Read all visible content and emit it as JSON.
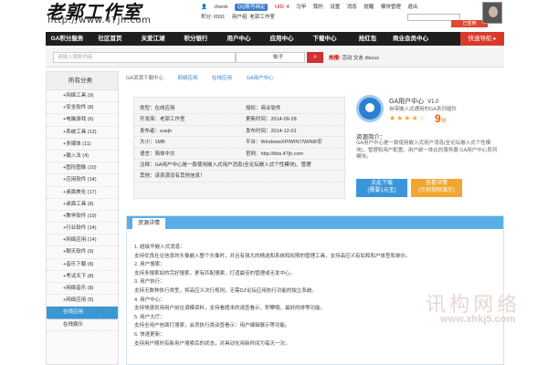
{
  "site": {
    "logo": "老郭工作室",
    "url": "http://www.47jh.com"
  },
  "userbar": {
    "user": "chenb",
    "qq": "QQ账号绑定",
    "uid": "UID: 4",
    "nav1": [
      "马甲",
      "我的",
      "设置",
      "消息",
      "提醒",
      "模块管理",
      "退出"
    ],
    "points": "积分: 6591",
    "group": "用户组: 老郭工作室",
    "search_placeholder": "",
    "go": "已签到"
  },
  "nav": [
    "GA积分服务",
    "社区首页",
    "关爱江湖",
    "积分银行",
    "用户中心",
    "应用中心",
    "下载中心",
    "抢红包",
    "商业会员中心",
    "快速导航 ▸"
  ],
  "searchbar": {
    "placeholder": "请输入搜索内容",
    "type": "帖子",
    "hot_label": "热搜:",
    "hot": [
      "活动",
      "交友",
      "discuz"
    ]
  },
  "sidebar": {
    "title": "所有分类",
    "items": [
      "+网络工具 (9)",
      "+安全软件 (8)",
      "+电脑游戏 (6)",
      "+系统工具 (13)",
      "+多媒体 (11)",
      "+输入法 (4)",
      "+图形图像 (10)",
      "+应用软件 (14)",
      "+桌面美化 (17)",
      "+桌面工具 (8)",
      "+教学软件 (19)",
      "+行业软件 (14)",
      "+网络应用 (14)",
      "+聊天软件 (9)",
      "+音乐下载 (8)",
      "+考试天下 (8)",
      "+网络音乐 (8)",
      "+网络应用 (5)",
      "在线应用",
      "在线娱乐"
    ],
    "active": 18
  },
  "crumb": [
    "GA资源下载中心",
    "网络应用",
    "在线应用",
    "GA用户中心"
  ],
  "info": [
    [
      "类型：在线应用",
      "授权：商业软件"
    ],
    [
      "开发商：老郭工作室",
      "更新时间：2014-09-28"
    ],
    [
      "发布者：xuejh",
      "发布时间：2014-12-01"
    ],
    [
      "大小：1MB",
      "平台：WindowsXP/WIN7/WIN8/安"
    ],
    [
      "语言：简体中文",
      "官网：http://bbs.47jh.com"
    ],
    [
      "注释：GA用户中心是一款使用嵌入式用户消息(全论坛嵌入式个性模块)、管理",
      ""
    ],
    [
      "其他：该资源没有其他信息！",
      ""
    ]
  ],
  "app": {
    "name": "GA用户中心",
    "ver": "V1.0",
    "desc": "自带嵌入式通用的GA系列插件",
    "score": "9",
    "unit": "分",
    "preview_title": "资源简介：",
    "preview": "GA用户中心是一款使用嵌入式用户消息(全论坛嵌入式个性模块)，管理和用户配置，用户统一体比的服务器 GA用户中心系列模块。",
    "btn1": [
      "点此下载",
      "(需要1元宝)"
    ],
    "btn2": [
      "查看详情",
      "(示例视频演示)"
    ]
  },
  "detail": {
    "tab": "资源详情",
    "lines": [
      "1. 超级华嵌入式消息：",
      "支持优良社论信息的头像嵌入整个头像时，并且有强大的精选和系统和权限的管理工具，支持高应义有如和和户体型和单价。",
      "2. 用户搜索：",
      "支持多搜索如的完好搜索，更有匹配搜索，打适最佳的管理或无发中心。",
      "3. 用户执行：",
      "支持无数种执行类型，将高应义次行规则，无需DZ论坛应用执行功能的独立系统。",
      "4. 用户中心：",
      "支持快速到用用户前往调模资料，支持看题本的请查看示，积攀哦，最好的排等功能。",
      "5. 用户大厅：",
      "支持全用户信面打搜索，会员执行类动查看示：用户编辑展示等功能。",
      "6. 快速更新：",
      "支持用户随时有新用户搜索后的状态，对具动化用新时间为每天一次。"
    ]
  },
  "watermark": {
    "text": "讯构网络",
    "url": "www.xhkj5.com"
  }
}
